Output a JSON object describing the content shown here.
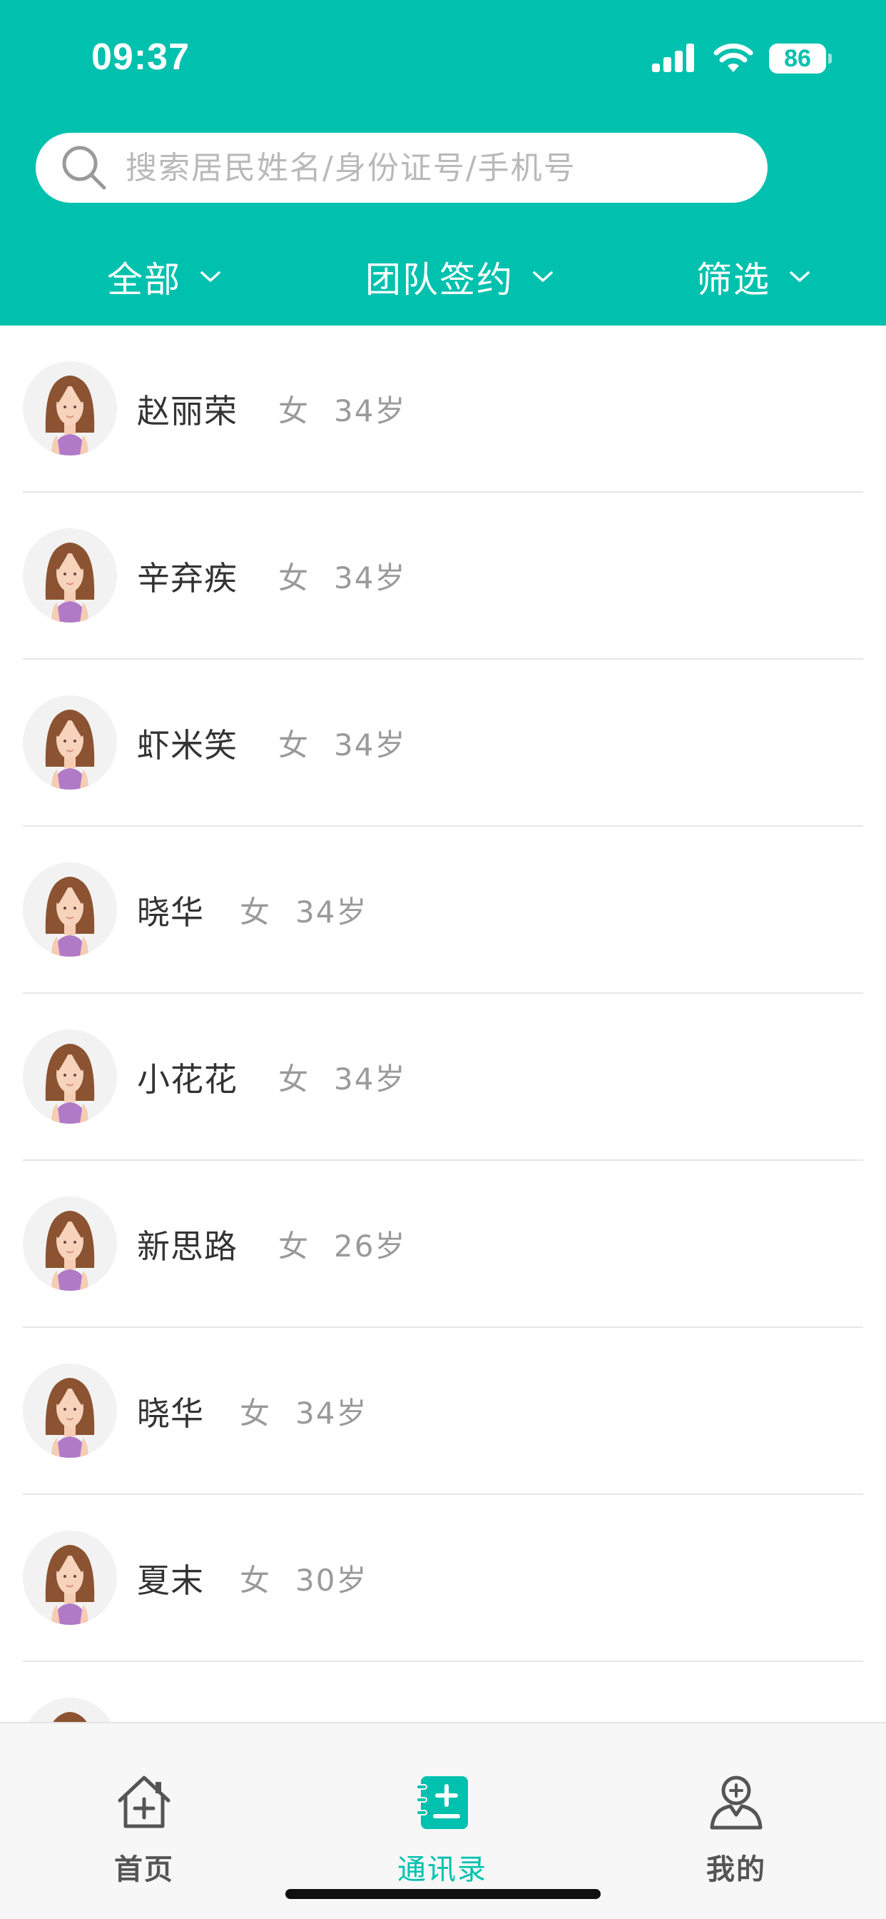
{
  "status_bar": {
    "time": "09:37",
    "battery": "86",
    "icons": [
      "cellular-signal-icon",
      "wifi-icon",
      "battery-icon"
    ]
  },
  "search": {
    "placeholder": "搜索居民姓名/身份证号/手机号",
    "value": ""
  },
  "filters": {
    "all": "全部",
    "team_sign": "团队签约",
    "screen": "筛选"
  },
  "residents": [
    {
      "name": "赵丽荣",
      "gender": "女",
      "age": "34岁"
    },
    {
      "name": "辛弃疾",
      "gender": "女",
      "age": "34岁"
    },
    {
      "name": "虾米笑",
      "gender": "女",
      "age": "34岁"
    },
    {
      "name": "晓华",
      "gender": "女",
      "age": "34岁"
    },
    {
      "name": "小花花",
      "gender": "女",
      "age": "34岁"
    },
    {
      "name": "新思路",
      "gender": "女",
      "age": "26岁"
    },
    {
      "name": "晓华",
      "gender": "女",
      "age": "34岁"
    },
    {
      "name": "夏末",
      "gender": "女",
      "age": "30岁"
    },
    {
      "name": "",
      "gender": "",
      "age": ""
    }
  ],
  "tabbar": {
    "home": "首页",
    "contacts": "通讯录",
    "mine": "我的",
    "active": "contacts"
  },
  "colors": {
    "primary": "#00c1ae",
    "text": "#333333",
    "muted": "#9a9a9a",
    "divider": "#e6e6e6"
  }
}
